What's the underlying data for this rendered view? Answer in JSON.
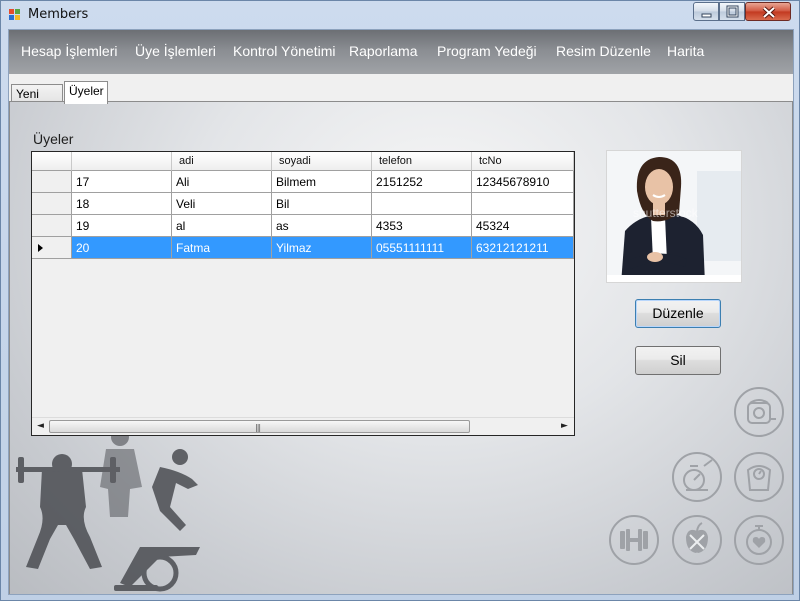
{
  "window": {
    "title": "Members",
    "icon": "app-window-icon",
    "controls": [
      "minimize-icon",
      "maximize-icon",
      "close-icon"
    ]
  },
  "menu": {
    "items": [
      {
        "label": "Hesap İşlemleri"
      },
      {
        "label": "Üye İşlemleri"
      },
      {
        "label": "Kontrol Yönetimi"
      },
      {
        "label": "Raporlama"
      },
      {
        "label": "Program Yedeği"
      },
      {
        "label": "Resim Düzenle"
      },
      {
        "label": "Harita"
      }
    ]
  },
  "tabs": [
    {
      "label": "Yeni Üye",
      "active": false
    },
    {
      "label": "Üyeler",
      "active": true
    }
  ],
  "members": {
    "section_label": "Üyeler",
    "columns": [
      "",
      "adi",
      "soyadi",
      "telefon",
      "tcNo"
    ],
    "rows": [
      [
        "17",
        "Ali",
        "Bilmem",
        "2151252",
        "12345678910"
      ],
      [
        "18",
        "Veli",
        "Bil",
        "",
        ""
      ],
      [
        "19",
        "al",
        "as",
        "4353",
        "45324"
      ],
      [
        "20",
        "Fatma",
        "Yilmaz",
        "05551111111",
        "63212121211"
      ]
    ],
    "selected_row": 3,
    "scrollbar": {
      "left_arrow": "◄",
      "right_arrow": "►",
      "grip": "|||"
    }
  },
  "actions": {
    "edit_label": "Düzenle",
    "delete_label": "Sil"
  },
  "photo": {
    "icon": "member-photo",
    "watermark": "shutterstock"
  },
  "decor": {
    "icons": [
      "measuring-tape-icon",
      "stopwatch-scale-icon",
      "scale-icon",
      "dumbbell-icon",
      "diet-apple-icon",
      "heart-timer-icon"
    ],
    "icon_color": "#9fa2a7",
    "selection_color": "#3399ff",
    "menu_text_color": "#ffffff"
  }
}
